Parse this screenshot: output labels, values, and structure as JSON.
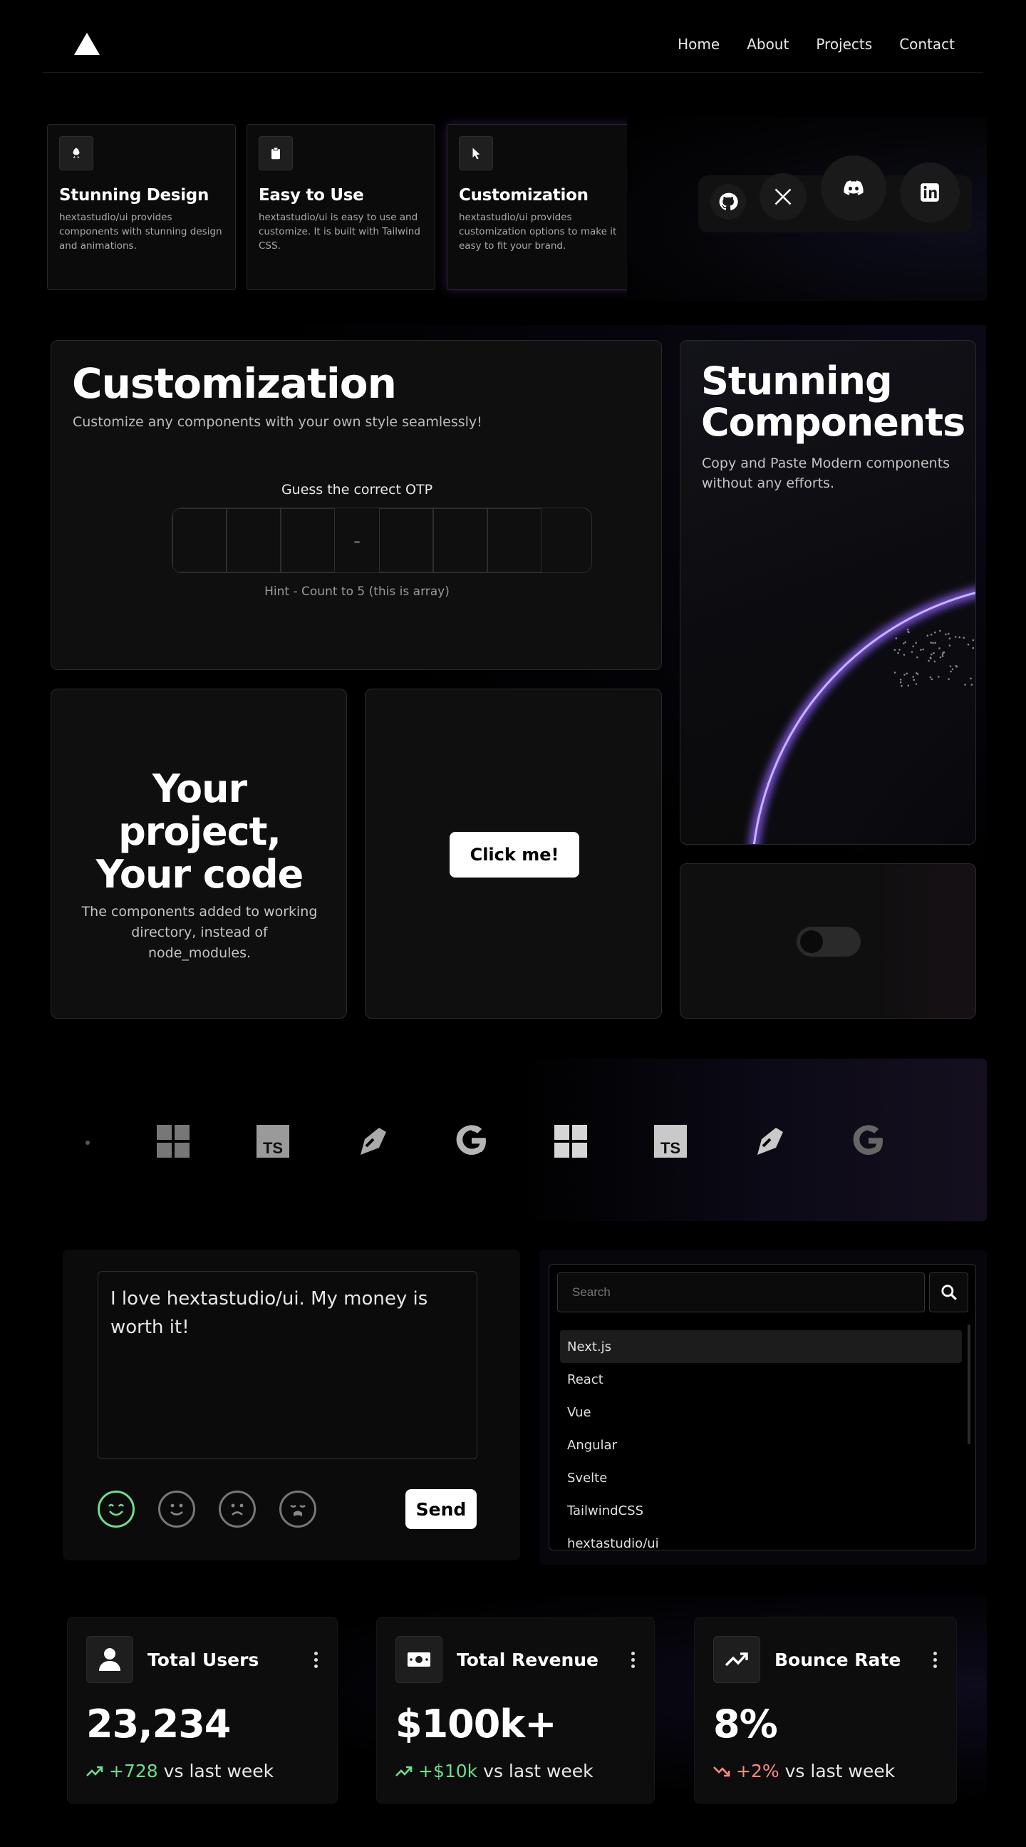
{
  "nav": {
    "links": [
      "Home",
      "About",
      "Projects",
      "Contact"
    ]
  },
  "features": [
    {
      "icon": "rocket-icon",
      "title": "Stunning Design",
      "desc": "hextastudio/ui provides components with stunning design and animations."
    },
    {
      "icon": "clipboard-icon",
      "title": "Easy to Use",
      "desc": "hextastudio/ui is easy to use and customize. It is built with Tailwind CSS."
    },
    {
      "icon": "cursor-icon",
      "title": "Customization",
      "desc": "hextastudio/ui provides customization options to make it easy to fit your brand."
    }
  ],
  "social": [
    "github-icon",
    "x-icon",
    "discord-icon",
    "linkedin-icon"
  ],
  "customization": {
    "title": "Customization",
    "subtitle": "Customize any components with your own style seamlessly!",
    "otp_label": "Guess the correct OTP",
    "otp_separator": "-",
    "hint": "Hint - Count to 5 (this is array)"
  },
  "components_card": {
    "title_line1": "Stunning",
    "title_line2": "Components",
    "desc": "Copy and Paste Modern components without any efforts."
  },
  "project_card": {
    "title": "Your project, Your code",
    "desc": "The components added to working directory, instead of node_modules."
  },
  "click_card": {
    "button": "Click me!"
  },
  "toggle": {
    "state": "off"
  },
  "logo_strip": [
    "windows-icon",
    "typescript-icon",
    "rocket-logo-icon",
    "google-icon",
    "windows-icon",
    "typescript-icon",
    "rocket-logo-icon",
    "google-icon"
  ],
  "feedback": {
    "text": "I love hextastudio/ui. My money is worth it!",
    "emojis": [
      "happy-emoji-icon",
      "neutral-emoji-icon",
      "sad-emoji-icon",
      "crying-emoji-icon"
    ],
    "selected_emoji": "happy-emoji-icon",
    "send": "Send"
  },
  "search": {
    "placeholder": "Search",
    "items": [
      "Next.js",
      "React",
      "Vue",
      "Angular",
      "Svelte",
      "TailwindCSS",
      "hextastudio/ui"
    ],
    "selected": "Next.js"
  },
  "stats": [
    {
      "icon": "user-icon",
      "title": "Total Users",
      "value": "23,234",
      "delta": "+728",
      "suffix": "vs last week",
      "trend": "up"
    },
    {
      "icon": "money-icon",
      "title": "Total Revenue",
      "value": "$100k+",
      "delta": "+$10k",
      "suffix": "vs last week",
      "trend": "up"
    },
    {
      "icon": "trend-up-icon",
      "title": "Bounce Rate",
      "value": "8%",
      "delta": "+2%",
      "suffix": "vs last week",
      "trend": "down"
    }
  ],
  "colors": {
    "up": "#6fdc8c",
    "down": "#ff8a80",
    "glow": "#8b5cf6"
  }
}
